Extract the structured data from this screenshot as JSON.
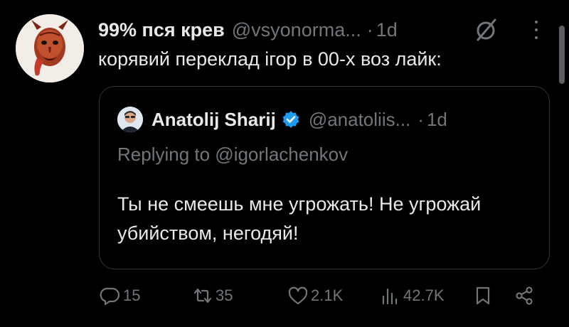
{
  "tweet": {
    "author_name": "99% пся крев",
    "author_handle": "@vsyonorma...",
    "separator": "·",
    "time": "1d",
    "text": "корявий переклад ігор в 00-х воз лайк:",
    "avatar_icon": "devil-mask-avatar",
    "grok_icon": "grok-slash-icon",
    "more_icon": "more-vertical-icon"
  },
  "quoted_tweet": {
    "author_name": "Anatolij Sharij",
    "author_handle": "@anatoliis...",
    "separator": "·",
    "time": "1d",
    "verified_icon": "verified-badge-icon",
    "replying_to": "Replying to @igorlachenkov",
    "text": "Ты не смеешь мне угрожать! Не угрожай убийством, негодяй!"
  },
  "actions": {
    "replies": "15",
    "reposts": "35",
    "likes": "2.1K",
    "views": "42.7K",
    "reply_icon": "reply-bubble-icon",
    "repost_icon": "repost-arrows-icon",
    "like_icon": "heart-icon",
    "views_icon": "views-bars-icon",
    "bookmark_icon": "bookmark-icon",
    "share_icon": "share-icon"
  },
  "colors": {
    "background": "#000000",
    "text_primary": "#e7e9ea",
    "text_secondary": "#71767b",
    "border": "#2f3336",
    "verified": "#1d9bf0"
  }
}
